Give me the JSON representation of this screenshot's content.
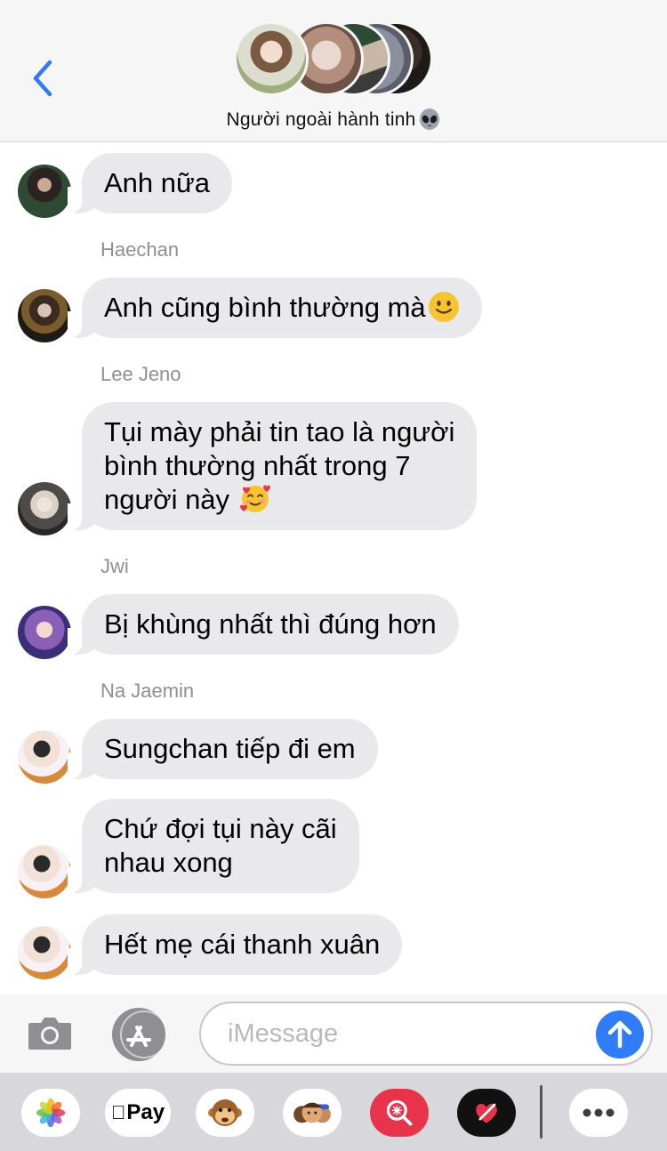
{
  "header": {
    "back_label": "",
    "group_title": "Người ngoài hành tinh",
    "title_emoji": "alien-emoji"
  },
  "messages": [
    {
      "sender": "",
      "text": "Anh nữa",
      "emoji": "",
      "avatar": "avatar-dark-green"
    },
    {
      "sender": "Haechan",
      "text": "Anh cũng bình thường mà",
      "emoji": "slightly-smiling-face",
      "avatar": "avatar-night-street"
    },
    {
      "sender": "Lee Jeno",
      "lines": [
        "Tụi mày phải tin tao là người",
        "bình thường nhất trong 7",
        "người này"
      ],
      "emoji": "smiling-face-with-hearts",
      "avatar": "avatar-blonde"
    },
    {
      "sender": "Jwi",
      "text": "Bị khùng nhất thì đúng hơn",
      "emoji": "",
      "avatar": "avatar-purple-hair"
    },
    {
      "sender": "Na Jaemin",
      "text": "Sungchan tiếp đi em",
      "emoji": "",
      "avatar": "avatar-with-cake"
    },
    {
      "sender": "",
      "lines": [
        "Chứ đợi tụi này cãi",
        "nhau xong"
      ],
      "emoji": "",
      "avatar": "avatar-with-cake"
    },
    {
      "sender": "",
      "text": "Hết mẹ cái thanh xuân",
      "emoji": "",
      "avatar": "avatar-with-cake"
    }
  ],
  "composer": {
    "placeholder": "iMessage",
    "camera_icon": "camera-icon",
    "apps_icon": "app-store-icon",
    "send_icon": "arrow-up-icon"
  },
  "drawer": {
    "apps": [
      {
        "name": "photos-app-icon"
      },
      {
        "name": "apple-pay-app",
        "label": "Pay"
      },
      {
        "name": "animoji-monkey-icon"
      },
      {
        "name": "memoji-icon"
      },
      {
        "name": "image-search-icon"
      },
      {
        "name": "digital-touch-heart-icon"
      },
      {
        "name": "more-apps-icon"
      }
    ]
  },
  "colors": {
    "accent": "#2f7cf6",
    "bubble_received": "#e9e9eb",
    "header_bg": "#f6f6f6",
    "drawer_bg": "#d7d7dc",
    "sender_name": "#8e8e93"
  }
}
